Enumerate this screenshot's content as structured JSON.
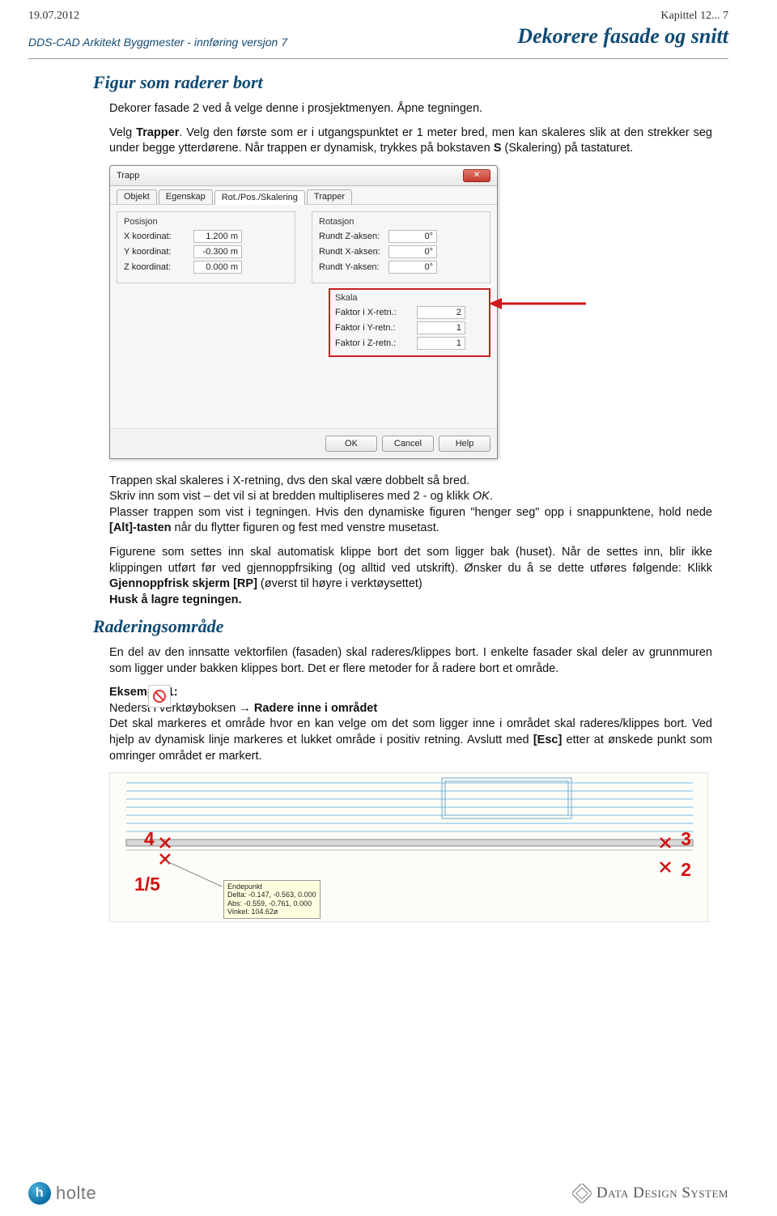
{
  "header": {
    "date": "19.07.2012",
    "chapter": "Kapittel 12... 7",
    "product": "DDS-CAD Arkitekt Byggmester - innføring versjon 7",
    "section": "Dekorere fasade og snitt"
  },
  "h1": "Figur som raderer bort",
  "p1_a": "Dekorer fasade 2 ved å velge denne i prosjektmenyen. Åpne tegningen.",
  "p2_a": "Velg ",
  "p2_b": "Trapper",
  "p2_c": ". Velg den første som er i utgangspunktet er 1 meter bred, men kan skaleres slik at den strekker seg under begge ytterdørene. Når trappen er dynamisk, trykkes på bokstaven ",
  "p2_d": "S",
  "p2_e": " (Skalering) på tastaturet.",
  "dialog": {
    "title": "Trapp",
    "tabs": [
      "Objekt",
      "Egenskap",
      "Rot./Pos./Skalering",
      "Trapper"
    ],
    "position": {
      "legend": "Posisjon",
      "x_label": "X koordinat:",
      "x_val": "1.200 m",
      "y_label": "Y koordinat:",
      "y_val": "-0.300 m",
      "z_label": "Z koordinat:",
      "z_val": "0.000 m"
    },
    "rotation": {
      "legend": "Rotasjon",
      "rz_label": "Rundt Z-aksen:",
      "rz_val": "0°",
      "rx_label": "Rundt X-aksen:",
      "rx_val": "0°",
      "ry_label": "Rundt Y-aksen:",
      "ry_val": "0°"
    },
    "scale": {
      "legend": "Skala",
      "fx_label": "Faktor i X-retn.:",
      "fx_val": "2",
      "fy_label": "Faktor i Y-retn.:",
      "fy_val": "1",
      "fz_label": "Faktor i Z-retn.:",
      "fz_val": "1"
    },
    "ok": "OK",
    "cancel": "Cancel",
    "help": "Help"
  },
  "p3_a": "Trappen skal skaleres i X-retning, dvs den skal være dobbelt så bred.",
  "p3_b": "Skriv inn som vist – det vil si at bredden multipliseres med 2 - og klikk ",
  "p3_ok": "OK",
  "p3_c": ".",
  "p3_d": "Plasser trappen som vist i tegningen. Hvis den dynamiske figuren \"henger seg\" opp i snappunktene, hold nede ",
  "p3_alt": "[Alt]-tasten",
  "p3_e": " når du flytter figuren og fest med venstre musetast.",
  "p4_a": "Figurene som settes inn skal automatisk klippe bort det som ligger bak (huset). Når de settes inn, blir ikke klippingen utført før ved gjennoppfrsiking (og alltid ved utskrift). Ønsker du å se dette utføres følgende: Klikk ",
  "p4_b": "Gjennoppfrisk skjerm [RP]",
  "p4_c": "  (øverst til høyre i verktøysettet)",
  "p4_d": "Husk å lagre tegningen.",
  "h2": "Raderingsområde",
  "p5": "En del av den innsatte vektorfilen (fasaden) skal raderes/klippes bort. I enkelte fasader skal deler av grunnmuren som ligger under bakken klippes bort. Det er flere metoder for å radere bort et område.",
  "ex1_title": "Eksempel 1:",
  "ex1_a": "Nederst i verktøyboksen → ",
  "ex1_b": "Radere inne i området",
  "ex1_c": "Det skal markeres et område hvor en kan velge om det som ligger inne i området skal raderes/klippes bort. Ved hjelp av dynamisk linje markeres et lukket område i positiv retning. Avslutt med ",
  "ex1_esc": "[Esc]",
  "ex1_d": " etter at ønskede punkt som omringer området er markert.",
  "tooltip": "Endepunkt\nDelta: -0.147, -0.563, 0.000\nAbs: -0.559, -0.761, 0.000\nVinkel: 104.62ø",
  "drawing_nums": {
    "n1": "1/5",
    "n2": "2",
    "n3": "3",
    "n4": "4"
  },
  "footer": {
    "holte": "holte",
    "dds": "Data Design System"
  }
}
